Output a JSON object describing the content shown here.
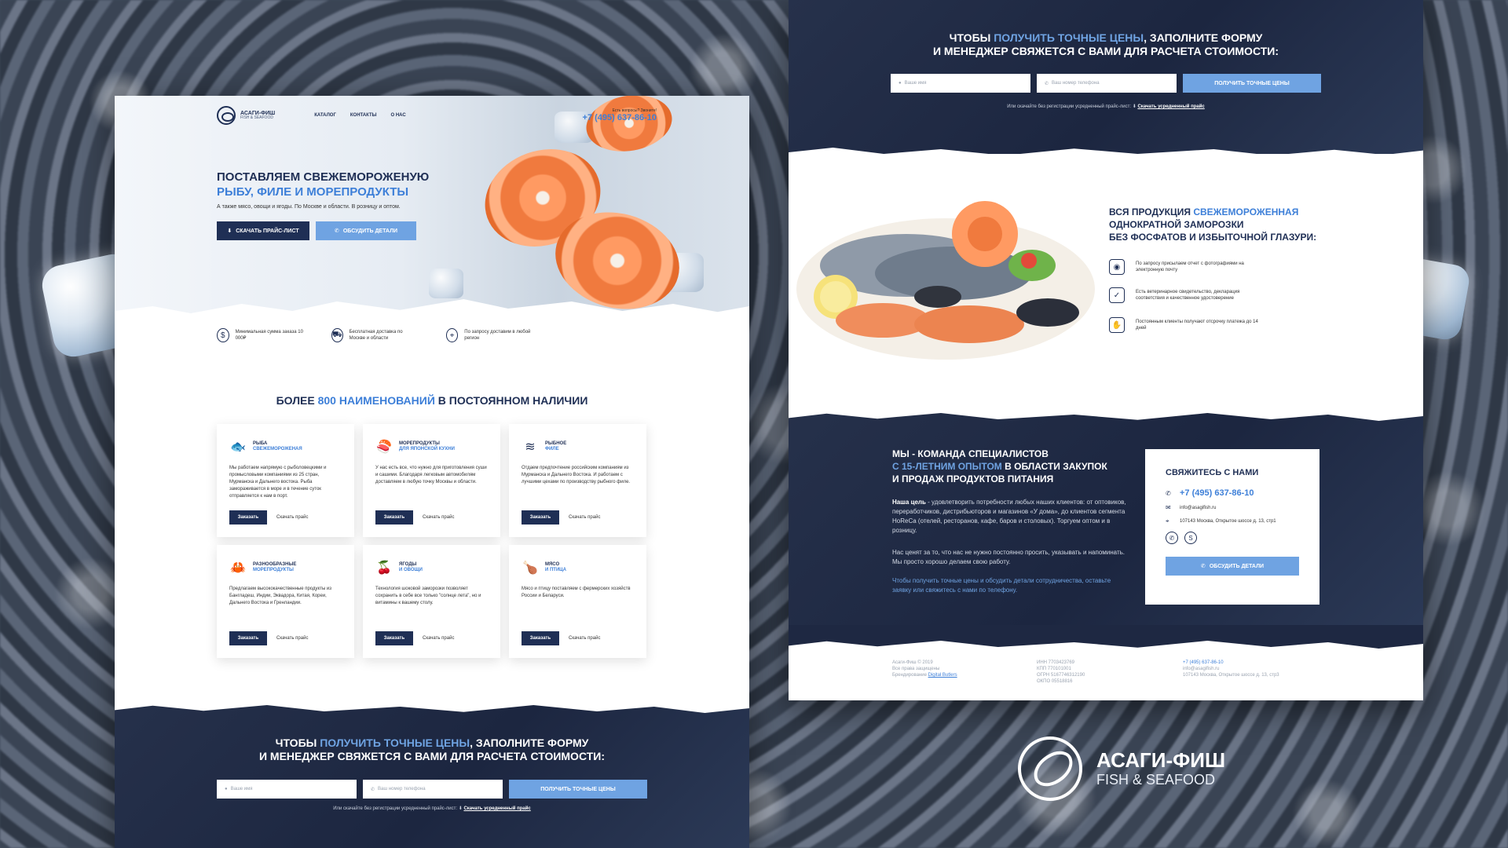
{
  "brand": {
    "name": "АСАГИ-ФИШ",
    "tagline": "FISH & SEAFOOD",
    "logo_small_name": "АСАГИ-ФИШ",
    "logo_small_tag": "FISH & SEAFOOD"
  },
  "header": {
    "nav": [
      "КАТАЛОГ",
      "КОНТАКТЫ",
      "О НАС"
    ],
    "phone_hint": "Есть вопросы? Звоните!",
    "phone": "+7 (495) 637-86-10"
  },
  "hero": {
    "title_line1": "ПОСТАВЛЯЕМ СВЕЖЕМОРОЖЕНУЮ",
    "title_line2": "РЫБУ, ФИЛЕ И МОРЕПРОДУКТЫ",
    "subtitle": "А также мясо, овощи и ягоды. По Москве и области. В розницу и оптом.",
    "btn_price": "СКАЧАТЬ ПРАЙС-ЛИСТ",
    "btn_discuss": "ОБСУДИТЬ ДЕТАЛИ"
  },
  "features": [
    {
      "icon": "money-bag-icon",
      "glyph": "$",
      "text": "Минимальная сумма заказа 10 000₽"
    },
    {
      "icon": "truck-icon",
      "glyph": "⛟",
      "text": "Бесплатная доставка по Москве и области"
    },
    {
      "icon": "location-pin-icon",
      "glyph": "⌖",
      "text": "По запросу доставим в любой регион"
    }
  ],
  "catalog": {
    "title_pre": "БОЛЕЕ ",
    "title_accent": "800 НАИМЕНОВАНИЙ",
    "title_post": " В ПОСТОЯННОМ НАЛИЧИИ",
    "cards": [
      {
        "icon": "fish-icon",
        "glyph": "🐟",
        "line1": "РЫБА",
        "line2": "СВЕЖЕМОРОЖЕНАЯ",
        "desc": "Мы работаем напрямую с рыболовецкими и промысловыми компаниями из 25 стран, Мурманска и Дальнего востока. Рыба замораживается в море и в течение суток отправляется к нам в порт.",
        "order": "Заказать",
        "price": "Скачать прайс"
      },
      {
        "icon": "sushi-icon",
        "glyph": "🍣",
        "line1": "МОРЕПРОДУКТЫ",
        "line2": "ДЛЯ ЯПОНСКОЙ КУХНИ",
        "desc": "У нас есть все, что нужно для приготовления суши и сашими. Благодаря легковым автомобилям доставляем в любую точку Москвы и области.",
        "order": "Заказать",
        "price": "Скачать прайс"
      },
      {
        "icon": "waves-icon",
        "glyph": "≋",
        "line1": "РЫБНОЕ",
        "line2": "ФИЛЕ",
        "desc": "Отдаем предпочтение российским компаниям из Мурманска и Дальнего Востока. И работаем с лучшими цехами по производству рыбного филе.",
        "order": "Заказать",
        "price": "Скачать прайс"
      },
      {
        "icon": "crab-icon",
        "glyph": "🦀",
        "line1": "РАЗНООБРАЗНЫЕ",
        "line2": "МОРЕПРОДУКТЫ",
        "desc": "Предлагаем высококачественные продукты из Бангладеш, Индии, Эквадора, Китая, Кореи, Дальнего Востока и Гренландии.",
        "order": "Заказать",
        "price": "Скачать прайс"
      },
      {
        "icon": "berries-icon",
        "glyph": "🍒",
        "line1": "ЯГОДЫ",
        "line2": "И ОВОЩИ",
        "desc": "Технология шоковой заморозки позволяет сохранить в себе все только \"солнце лета\", но и витамины к вашему столу.",
        "order": "Заказать",
        "price": "Скачать прайс"
      },
      {
        "icon": "meat-icon",
        "glyph": "🍗",
        "line1": "МЯСО",
        "line2": "И ПТИЦА",
        "desc": "Мясо и птицу поставляем с фермерских хозяйств России и Беларуси.",
        "order": "Заказать",
        "price": "Скачать прайс"
      }
    ]
  },
  "lead_form": {
    "title_pre": "ЧТОБЫ ",
    "title_accent": "ПОЛУЧИТЬ ТОЧНЫЕ ЦЕНЫ",
    "title_post": ", ЗАПОЛНИТЕ ФОРМУ",
    "title_line2": "И МЕНЕДЖЕР СВЯЖЕТСЯ С ВАМИ ДЛЯ РАСЧЕТА СТОИМОСТИ:",
    "name_placeholder": "Ваше имя",
    "phone_placeholder": "Ваш номер телефона",
    "submit": "ПОЛУЧИТЬ ТОЧНЫЕ ЦЕНЫ",
    "note": "Или скачайте без регистрации усредненный прайс-лист:",
    "note_link": "Скачать усредненный прайс"
  },
  "quality": {
    "title_pre": "ВСЯ ПРОДУКЦИЯ ",
    "title_accent": "СВЕЖЕМОРОЖЕННАЯ",
    "title_line2": "ОДНОКРАТНОЙ ЗАМОРОЗКИ",
    "title_line3": "БЕЗ ФОСФАТОВ И ИЗБЫТОЧНОЙ ГЛАЗУРИ:",
    "items": [
      {
        "icon": "camera-icon",
        "glyph": "◉",
        "text": "По запросу присылаем отчет с фотографиями на электронную почту"
      },
      {
        "icon": "certificate-icon",
        "glyph": "✓",
        "text": "Есть ветеринарное свидетельство, декларация соответствия и качественное удостоверение"
      },
      {
        "icon": "handshake-icon",
        "glyph": "✋",
        "text": "Постоянным клиенты получают отсрочку платежа до 14 дней"
      }
    ]
  },
  "team": {
    "title_line1": "МЫ - КОМАНДА СПЕЦИАЛИСТОВ",
    "title_accent": "С 15-ЛЕТНИМ ОПЫТОМ",
    "title_line2_post": " В ОБЛАСТИ ЗАКУПОК",
    "title_line3": "И ПРОДАЖ ПРОДУКТОВ ПИТАНИЯ",
    "goal_label": "Наша цель",
    "goal_text": " - удовлетворить потребности любых наших клиентов: от оптовиков, переработчиков, дистрибьюторов и магазинов «У дома», до клиентов сегмента HoReCa (отелей, ресторанов, кафе, баров и столовых). Торгуем оптом и в розницу.",
    "para2": "Нас ценят за то, что нас не нужно постоянно просить, указывать и напоминать. Мы просто хорошо делаем свою работу.",
    "para3": "Чтобы получить точные цены и обсудить детали сотрудничества, оставьте заявку или свяжитесь с нами по телефону."
  },
  "contact": {
    "title": "СВЯЖИТЕСЬ С НАМИ",
    "phone": "+7 (495) 637-86-10",
    "email": "info@asagifish.ru",
    "address": "107143 Москва, Открытое шоссе д. 13, стр1",
    "button": "ОБСУДИТЬ ДЕТАЛИ"
  },
  "footer": {
    "col1": [
      "Асаги-Фиш © 2019",
      "Все права защищены",
      "Брендирование"
    ],
    "col1_link": "Digital Butlers",
    "col2": [
      "ИНН 7703423769",
      "КПП 770101001",
      "ОГРН 5167746312190",
      "ОКПО 05518816"
    ],
    "col3_phone": "+7 (495) 637-86-10",
    "col3": [
      "info@asagifish.ru",
      "107143 Москва, Открытое шоссе д. 13, стр3"
    ]
  }
}
